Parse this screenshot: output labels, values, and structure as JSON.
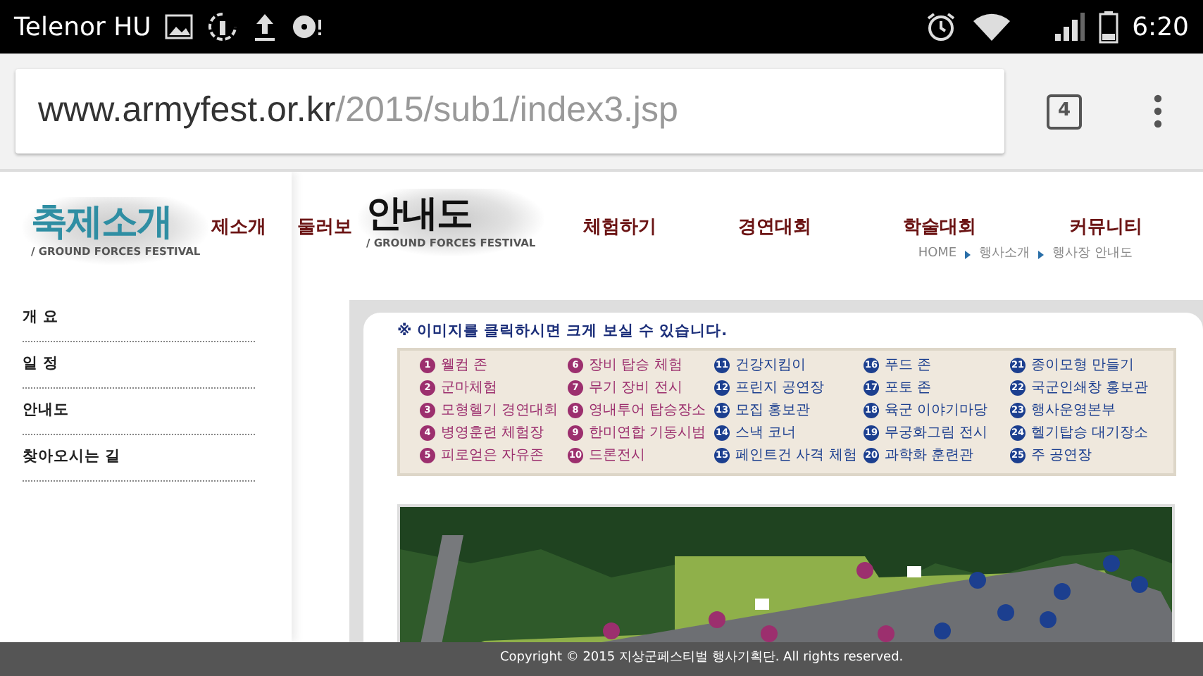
{
  "status_bar": {
    "carrier": "Telenor HU",
    "time": "6:20"
  },
  "browser": {
    "url_host": "www.armyfest.or.kr",
    "url_path": "/2015/sub1/index3.jsp",
    "tab_count": "4"
  },
  "site_header": {
    "logo": {
      "title": "축제소개",
      "subtitle": "/ GROUND FORCES FESTIVAL"
    },
    "nav": [
      "제소개",
      "둘러보",
      "체험하기",
      "경연대회",
      "학술대회",
      "커뮤니티"
    ],
    "page_logo": {
      "title": "안내도",
      "subtitle": "/ GROUND FORCES FESTIVAL"
    },
    "breadcrumb": [
      "HOME",
      "행사소개",
      "행사장 안내도"
    ]
  },
  "sidebar": {
    "items": [
      "개 요",
      "일 정",
      "안내도",
      "찾아오시는 길"
    ]
  },
  "notice": "※ 이미지를 클릭하시면 크게 보실 수 있습니다.",
  "legend": [
    {
      "number": "1",
      "label": "웰컴 존",
      "color": "#9c2f6e"
    },
    {
      "number": "2",
      "label": "군마체험",
      "color": "#9c2f6e"
    },
    {
      "number": "3",
      "label": "모형헬기 경연대회",
      "color": "#9c2f6e"
    },
    {
      "number": "4",
      "label": "병영훈련 체험장",
      "color": "#9c2f6e"
    },
    {
      "number": "5",
      "label": "피로얻은 자유존",
      "color": "#9c2f6e"
    },
    {
      "number": "6",
      "label": "장비 탑승 체험",
      "color": "#9c2f6e"
    },
    {
      "number": "7",
      "label": "무기 장비 전시",
      "color": "#9c2f6e"
    },
    {
      "number": "8",
      "label": "영내투어 탑승장소",
      "color": "#9c2f6e"
    },
    {
      "number": "9",
      "label": "한미연합 기동시범",
      "color": "#9c2f6e"
    },
    {
      "number": "10",
      "label": "드론전시",
      "color": "#9c2f6e"
    },
    {
      "number": "11",
      "label": "건강지킴이",
      "color": "#1c3f8f"
    },
    {
      "number": "12",
      "label": "프린지 공연장",
      "color": "#1c3f8f"
    },
    {
      "number": "13",
      "label": "모집 홍보관",
      "color": "#1c3f8f"
    },
    {
      "number": "14",
      "label": "스낵 코너",
      "color": "#1c3f8f"
    },
    {
      "number": "15",
      "label": "페인트건 사격 체험",
      "color": "#1c3f8f"
    },
    {
      "number": "16",
      "label": "푸드 존",
      "color": "#1c3f8f"
    },
    {
      "number": "17",
      "label": "포토 존",
      "color": "#1c3f8f"
    },
    {
      "number": "18",
      "label": "육군 이야기마당",
      "color": "#1c3f8f"
    },
    {
      "number": "19",
      "label": "무궁화그림 전시",
      "color": "#1c3f8f"
    },
    {
      "number": "20",
      "label": "과학화 훈련관",
      "color": "#1c3f8f"
    },
    {
      "number": "21",
      "label": "종이모형 만들기",
      "color": "#1c3f8f"
    },
    {
      "number": "22",
      "label": "국군인쇄창 홍보관",
      "color": "#1c3f8f"
    },
    {
      "number": "23",
      "label": "행사운영본부",
      "color": "#1c3f8f"
    },
    {
      "number": "24",
      "label": "헬기탑승 대기장소",
      "color": "#1c3f8f"
    },
    {
      "number": "25",
      "label": "주 공연장",
      "color": "#1c3f8f"
    }
  ],
  "footer": "Copyright © 2015 지상군페스티벌 행사기획단. All rights reserved."
}
